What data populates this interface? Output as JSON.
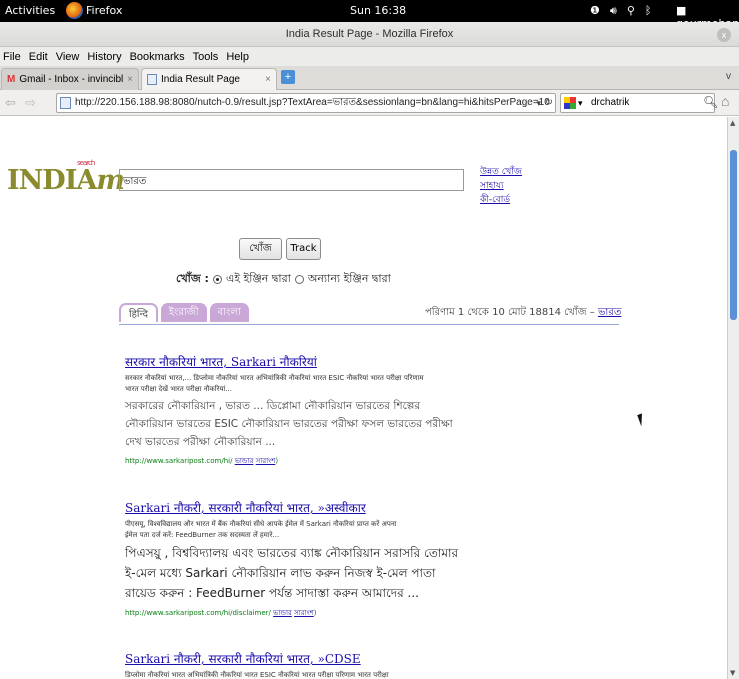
{
  "system": {
    "activities": "Activities",
    "app_name": "Firefox",
    "clock": "Sun 16:38",
    "user": "gourmohan"
  },
  "window": {
    "title": "India Result Page - Mozilla Firefox",
    "close": "x"
  },
  "menu": [
    "File",
    "Edit",
    "View",
    "History",
    "Bookmarks",
    "Tools",
    "Help"
  ],
  "tabs": [
    {
      "label": "Gmail - Inbox - invincible.roy...",
      "close": "×"
    },
    {
      "label": "India Result Page",
      "close": "×"
    }
  ],
  "newtab": "+",
  "tabs_chevron": "v",
  "nav": {
    "url": "http://220.156.188.98:8080/nutch-0.9/result.jsp?TextArea=ভারত&sessionlang=bn&lang=hi&hitsPerPage=10",
    "search_engine_value": "drchatrik"
  },
  "page": {
    "logo": "INDIA",
    "logo_suffix": "m",
    "logo_small": "search",
    "query": "ভারত",
    "side_links": [
      "উন্নত খোঁজ",
      "সাহায্য",
      "কী-বোর্ড"
    ],
    "search_button": "খোঁজ",
    "track_button": "Track",
    "search_label": "খোঁজ :",
    "radio_this": "এই ইঞ্জিন দ্বারা",
    "radio_other": "অন্যান্য ইঞ্জিন দ্বারা",
    "lang_tabs": [
      "हिन्दि",
      "ইংরাজী",
      "বাংলা"
    ],
    "result_count_text": "পরিণাম 1 থেকে 10 মোট 18814 খোঁজ –",
    "result_count_query": "ভারত"
  },
  "results": [
    {
      "title": "सरकार नौकरियां भारत, Sarkari नौकरियां",
      "snippet_hi_1": "सरकार नौकरियां भारत,... डिप्लोमा नौकरियां भारत अभियांत्रिकी नौकरियां भारत ESIC नौकरियां भारत परीक्षा परिणाम",
      "snippet_hi_2": "भारत परीक्षा देखें भारत परीक्षा नौकरियां...",
      "snippet_bn": "সরকারের নৌকারিয়ান , ভারত ... ডিপ্লোমা নৌকারিয়ান ভারতের শিল্পের নৌকারিয়ান ভারতের ESIC নৌকারিয়ান ভারতের পরীক্ষা ফসল ভারতের পরীক্ষা দেখ ভারতের পরীক্ষা নৌকারিয়ান ...",
      "url": "http://www.sarkaripost.com/hi/",
      "link1": "ভান্ডার",
      "link2": "সারাংশ"
    },
    {
      "title": "Sarkari नौकरी, सरकारी नौकरियां भारत, »अस्वीकार",
      "snippet_hi_1": "पीएसयू, विश्वविद्यालय और भारत में बैंक नौकरियां सीधे आपके ईमेल में Sarkari नौकरियां प्राप्त करें अपना",
      "snippet_hi_2": "ईमेल पता दर्ज करें: FeedBurner तक सदस्यता लें हमारे...",
      "snippet_bn": "পিএসয়ু , বিশ্ববিদ্যালয় এবং ভারতের ব্যাঙ্ক নৌকারিয়ান সরাসরি তোমার ই-মেল মধ্যে Sarkari নৌকারিয়ান লাভ করুন নিজস্ব ই-মেল পাতা রায়েড করুন : FeedBurner পর্যন্ত সাদাস্তা করুন আমাদের ...",
      "url": "http://www.sarkaripost.com/hi/disclaimer/",
      "link1": "ভান্ডার",
      "link2": "সারাংশ"
    },
    {
      "title": "Sarkari नौकरी, सरकारी नौकरियां भारत, »CDSE",
      "snippet_hi_1": "डिप्लोमा नौकरियां भारत अभियांत्रिकी नौकरियां भारत ESIC नौकरियां भारत परीक्षा परिणाम भारत परीक्षा"
    }
  ]
}
